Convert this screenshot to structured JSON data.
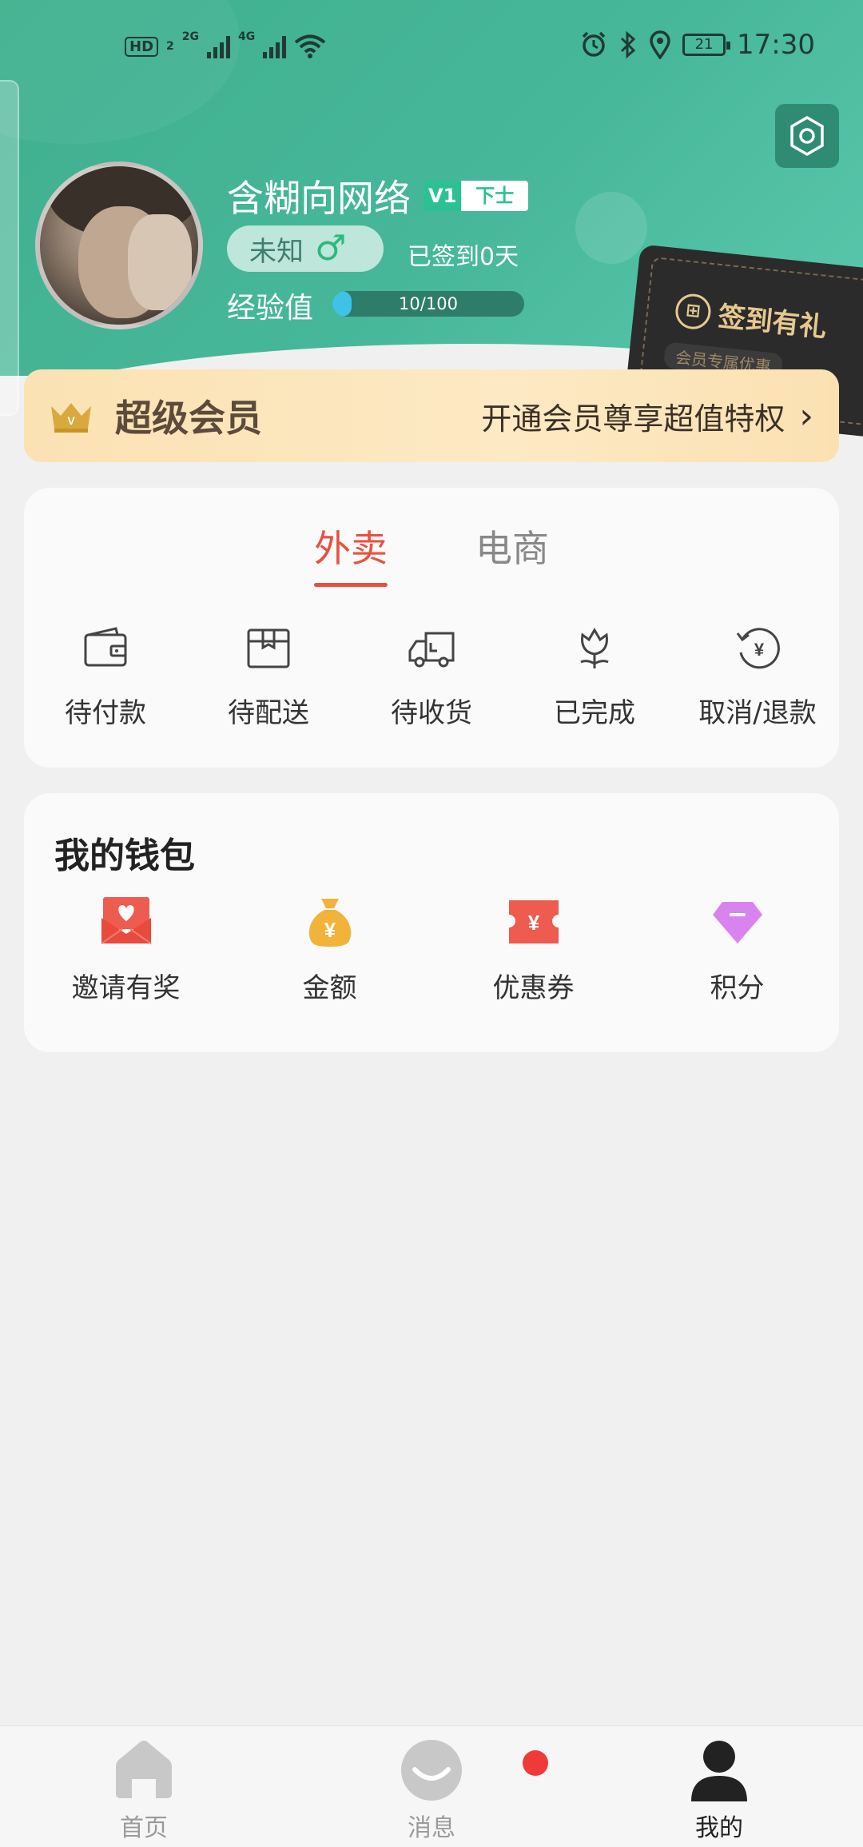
{
  "status_bar": {
    "hd": "HD",
    "hd_sub": "2",
    "net1": "2G",
    "net2": "4G",
    "battery": "21",
    "time": "17:30"
  },
  "profile": {
    "name": "含糊向网络",
    "vip_level": "V1",
    "rank": "下士",
    "gender": "未知",
    "gender_symbol": "♂",
    "signed_days": "已签到0天",
    "exp_label": "经验值",
    "exp_text": "10/100",
    "exp_progress": 0.1
  },
  "signin_card": {
    "title": "签到有礼",
    "subtitle": "会员专属优惠"
  },
  "member_banner": {
    "title": "超级会员",
    "desc": "开通会员尊享超值特权"
  },
  "order_tabs": [
    {
      "label": "外卖",
      "active": true
    },
    {
      "label": "电商",
      "active": false
    }
  ],
  "orders": [
    {
      "label": "待付款",
      "icon": "wallet-icon"
    },
    {
      "label": "待配送",
      "icon": "package-icon"
    },
    {
      "label": "待收货",
      "icon": "truck-icon"
    },
    {
      "label": "已完成",
      "icon": "flower-icon"
    },
    {
      "label": "取消/退款",
      "icon": "refund-icon"
    }
  ],
  "wallet": {
    "title": "我的钱包",
    "items": [
      {
        "label": "邀请有奖",
        "icon": "invite-envelope-icon",
        "color": "#ee5b4f"
      },
      {
        "label": "金额",
        "icon": "money-bag-icon",
        "color": "#f2b33a"
      },
      {
        "label": "优惠券",
        "icon": "coupon-icon",
        "color": "#ee5b4f"
      },
      {
        "label": "积分",
        "icon": "diamond-icon",
        "color": "#d984ee"
      }
    ]
  },
  "bottom_nav": [
    {
      "label": "首页",
      "icon": "home-icon",
      "active": false
    },
    {
      "label": "消息",
      "icon": "message-icon",
      "active": false
    },
    {
      "label": "我的",
      "icon": "user-icon",
      "active": true
    }
  ],
  "colors": {
    "header_green": "#47b79a",
    "accent_red": "#e8513f",
    "member_gold": "#fbe2b3"
  }
}
